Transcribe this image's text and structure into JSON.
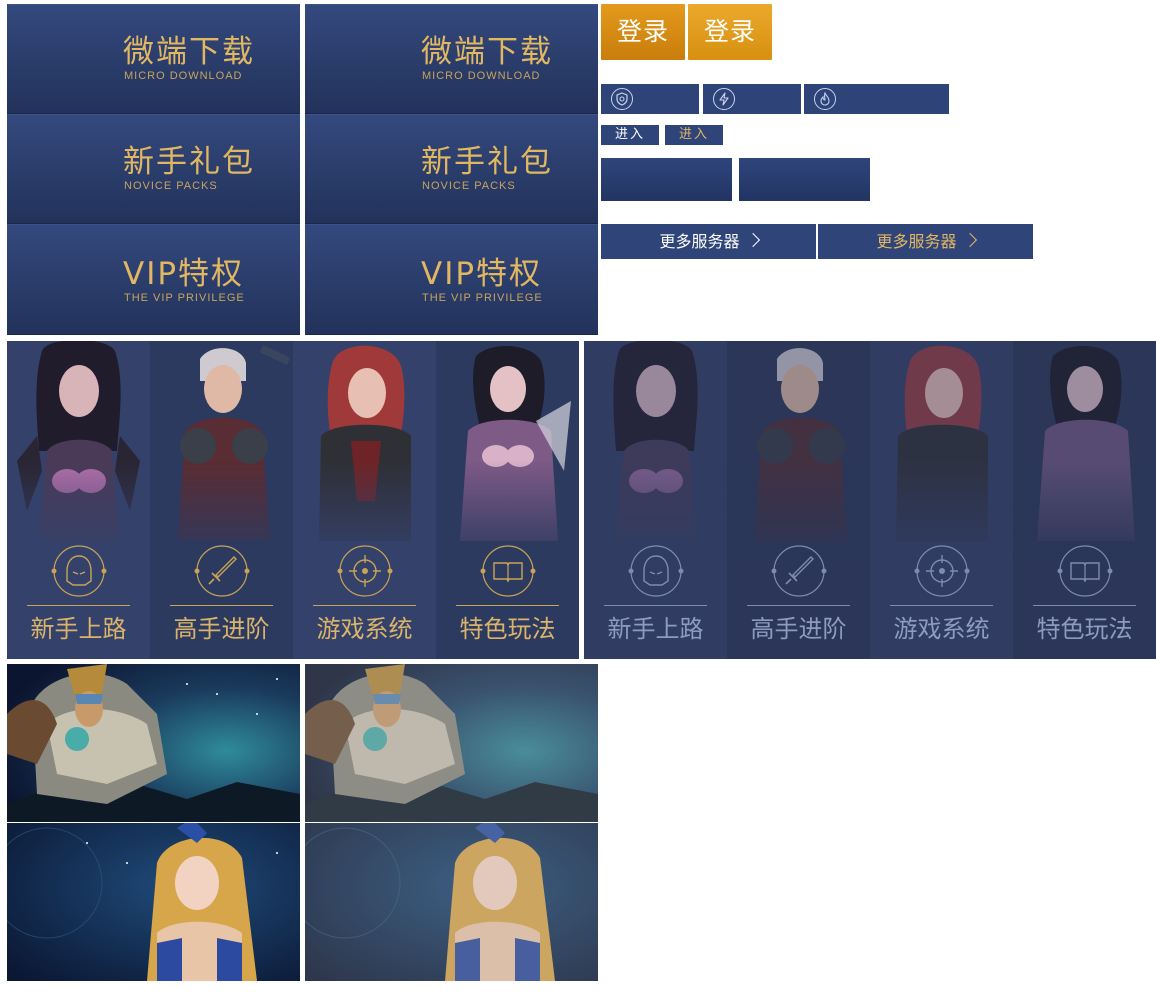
{
  "nav_tiles": [
    {
      "cn": "微端下载",
      "en": "MICRO DOWNLOAD"
    },
    {
      "cn": "新手礼包",
      "en": "NOVICE PACKS"
    },
    {
      "cn": "VIP特权",
      "en": "THE VIP PRIVILEGE"
    }
  ],
  "login": {
    "label_a": "登录",
    "label_b": "登录"
  },
  "enter": {
    "label_a": "进入",
    "label_b": "进入"
  },
  "more_servers": {
    "label_a": "更多服务器",
    "label_b": "更多服务器"
  },
  "icons": [
    "shield-icon",
    "lightning-icon",
    "flame-icon"
  ],
  "guides": [
    {
      "label": "新手上路",
      "icon": "helmet-icon"
    },
    {
      "label": "高手进阶",
      "icon": "sword-icon"
    },
    {
      "label": "游戏系统",
      "icon": "target-icon"
    },
    {
      "label": "特色玩法",
      "icon": "book-icon"
    }
  ],
  "colors": {
    "navy": "#2e4479",
    "gold": "#e1b861",
    "login_orange": "#d78d12",
    "panel_bg": "#2d3a60",
    "muted_label": "#8d9bc0"
  }
}
